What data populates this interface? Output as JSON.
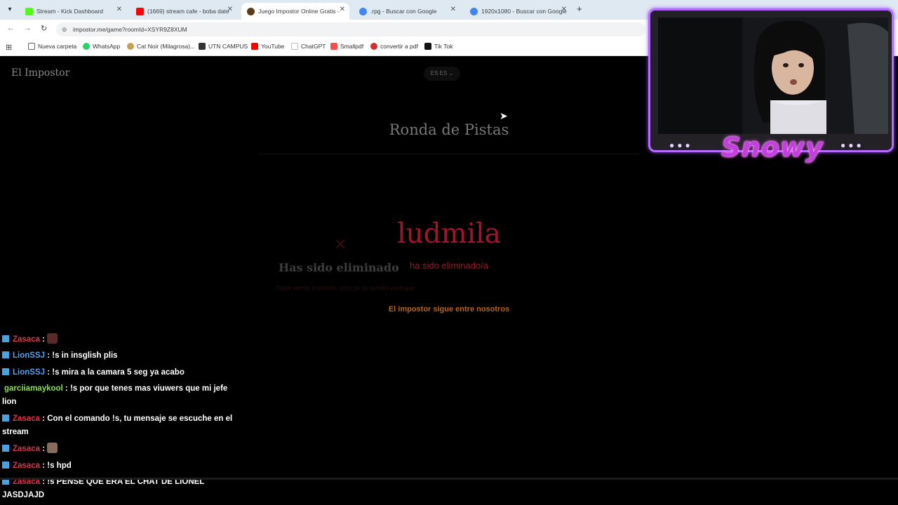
{
  "browser": {
    "tabs": [
      {
        "title": "Stream - Kick Dashboard",
        "favicon_color": "#53fc18"
      },
      {
        "title": "(1669) stream cafe - boba date",
        "favicon_color": "#ff0000"
      },
      {
        "title": "Juego Impostor Online Gratis -",
        "favicon_color": "#5b3a1a"
      },
      {
        "title": ".rpg - Buscar con Google",
        "favicon_color": "#4285f4"
      },
      {
        "title": "1920x1080 - Buscar con Google",
        "favicon_color": "#4285f4"
      }
    ],
    "new_tab": "+",
    "url": "impostor.me/game?roomId=XSYR9Z8XUM",
    "bookmarks": [
      {
        "label": "Nueva carpeta",
        "color": "#666666"
      },
      {
        "label": "WhatsApp",
        "color": "#25d366"
      },
      {
        "label": "Cat Noir (Milagrosa)...",
        "color": "#c8a050"
      },
      {
        "label": "UTN CAMPUS",
        "color": "#333333"
      },
      {
        "label": "YouTube",
        "color": "#ff0000"
      },
      {
        "label": "ChatGPT",
        "color": "#ffffff"
      },
      {
        "label": "Smallpdf",
        "color": "#ff4b4b"
      },
      {
        "label": "convertir a pdf",
        "color": "#d32f2f"
      },
      {
        "label": "Tik Tok",
        "color": "#111111"
      }
    ]
  },
  "game": {
    "site_title": "El Impostor",
    "language": "ES ES",
    "round_title": "Ronda de Pistas",
    "ghost_title": "Has sido eliminado",
    "ghost_subtitle": "Sigue viendo la partida, pero ya no puedes participar",
    "player_name": "ludmila",
    "eliminated_text": "ha sido eliminado/a",
    "impostor_status": "El impostor sigue entre nosotros"
  },
  "chat": {
    "messages": [
      {
        "user": "Zasaca",
        "user_color": "#e0334c",
        "text": "",
        "emote_color": "#5a2a2a"
      },
      {
        "user": "LionSSJ",
        "user_color": "#5aa0e6",
        "text": "!s in insglish plis"
      },
      {
        "user": "LionSSJ",
        "user_color": "#5aa0e6",
        "text": "!s mira a la camara 5 seg ya acabo"
      },
      {
        "user": "garciiamaykool",
        "user_color": "#8be04e",
        "text": "!s por que tenes mas viuwers que mi jefe lion"
      },
      {
        "user": "Zasaca",
        "user_color": "#e0334c",
        "text": "Con el comando !s, tu mensaje se escuche en el stream"
      },
      {
        "user": "Zasaca",
        "user_color": "#e0334c",
        "text": "",
        "emote_color": "#8a6a5a"
      },
      {
        "user": "Zasaca",
        "user_color": "#e0334c",
        "text": "!s hpd"
      },
      {
        "user": "Zasaca",
        "user_color": "#e0334c",
        "text": "!s PENSE QUE ERA EL CHAT DE LIONEL JASDJAJD"
      }
    ]
  },
  "webcam": {
    "streamer_name": "Snowy",
    "accent_color": "#b36cff"
  }
}
